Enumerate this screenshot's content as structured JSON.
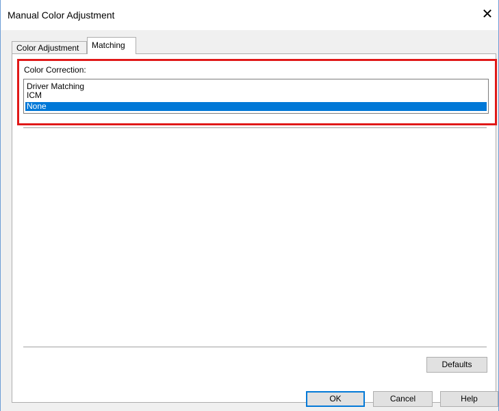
{
  "window": {
    "title": "Manual Color Adjustment",
    "close_glyph": "✕"
  },
  "tabs": [
    {
      "label": "Color Adjustment",
      "selected": false
    },
    {
      "label": "Matching",
      "selected": true
    }
  ],
  "color_correction": {
    "label": "Color Correction:",
    "options": [
      "Driver Matching",
      "ICM",
      "None"
    ],
    "selected": "None"
  },
  "buttons": {
    "defaults": "Defaults",
    "ok": "OK",
    "cancel": "Cancel",
    "help": "Help"
  },
  "colors": {
    "selection": "#0078d7",
    "highlight_box": "#e01818",
    "window_border": "#6b9bd6"
  }
}
